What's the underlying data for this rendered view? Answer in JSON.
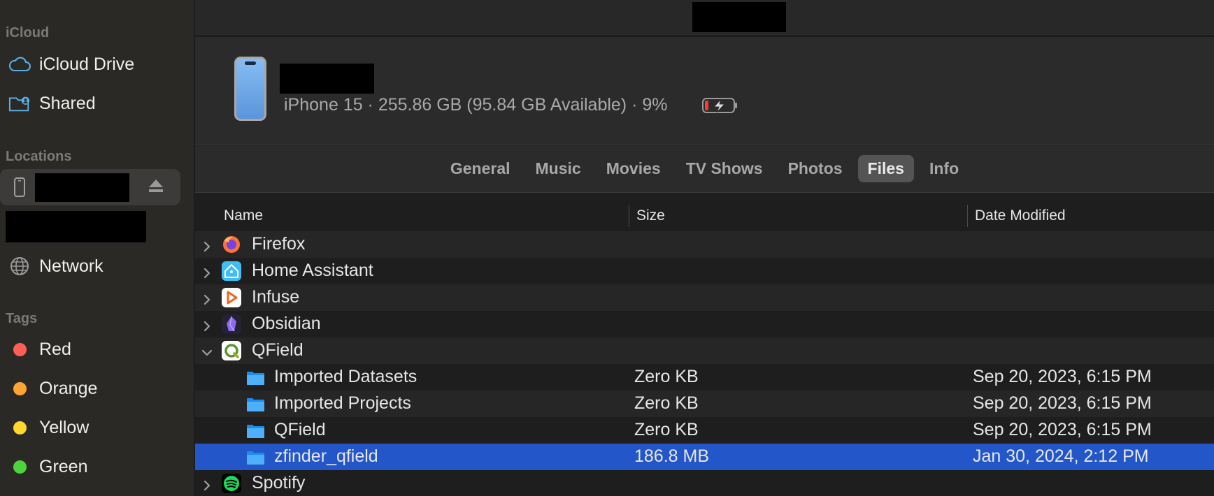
{
  "sidebar": {
    "icloud_header": "iCloud",
    "icloud_items": [
      {
        "label": "iCloud Drive",
        "icon": "cloud-icon"
      },
      {
        "label": "Shared",
        "icon": "shared-folder-icon"
      }
    ],
    "locations_header": "Locations",
    "network_label": "Network",
    "tags_header": "Tags",
    "tags": [
      {
        "label": "Red",
        "color": "#fe5f57"
      },
      {
        "label": "Orange",
        "color": "#fea431"
      },
      {
        "label": "Yellow",
        "color": "#fdd630"
      },
      {
        "label": "Green",
        "color": "#4cd43d"
      }
    ]
  },
  "device": {
    "info": "iPhone 15 · 255.86 GB (95.84 GB Available) · 9%",
    "battery_level": 9
  },
  "tabs": [
    "General",
    "Music",
    "Movies",
    "TV Shows",
    "Photos",
    "Files",
    "Info"
  ],
  "active_tab": "Files",
  "columns": {
    "name": "Name",
    "size": "Size",
    "date": "Date Modified"
  },
  "rows": [
    {
      "type": "app",
      "name": "Firefox",
      "icon": "firefox-icon",
      "expanded": false
    },
    {
      "type": "app",
      "name": "Home Assistant",
      "icon": "home-assistant-icon",
      "expanded": false
    },
    {
      "type": "app",
      "name": "Infuse",
      "icon": "infuse-icon",
      "expanded": false
    },
    {
      "type": "app",
      "name": "Obsidian",
      "icon": "obsidian-icon",
      "expanded": false
    },
    {
      "type": "app",
      "name": "QField",
      "icon": "qfield-icon",
      "expanded": true
    },
    {
      "type": "folder",
      "name": "Imported Datasets",
      "size": "Zero KB",
      "date": "Sep 20, 2023, 6:15 PM"
    },
    {
      "type": "folder",
      "name": "Imported Projects",
      "size": "Zero KB",
      "date": "Sep 20, 2023, 6:15 PM"
    },
    {
      "type": "folder",
      "name": "QField",
      "size": "Zero KB",
      "date": "Sep 20, 2023, 6:15 PM"
    },
    {
      "type": "folder",
      "name": "zfinder_qfield",
      "size": "186.8 MB",
      "date": "Jan 30, 2024, 2:12 PM",
      "selected": true
    },
    {
      "type": "app",
      "name": "Spotify",
      "icon": "spotify-icon",
      "expanded": false
    }
  ]
}
